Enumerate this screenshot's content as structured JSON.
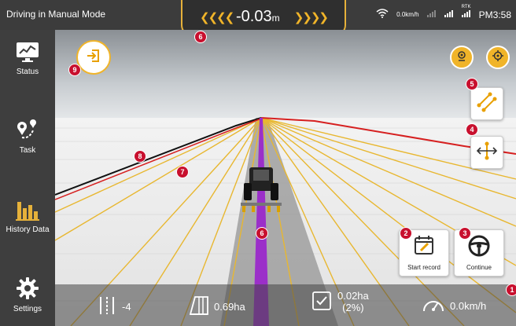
{
  "status_bar": {
    "mode": "Driving in Manual Mode",
    "speed_label": "0.0km/h",
    "rtk_label": "RTK",
    "time": "PM3:58"
  },
  "offset": {
    "value": "-0.03",
    "unit": "m"
  },
  "sidebar": {
    "items": [
      {
        "label": "Status"
      },
      {
        "label": "Task"
      },
      {
        "label": "History Data"
      },
      {
        "label": "Settings"
      }
    ]
  },
  "actions": {
    "start_record": "Start record",
    "continue": "Continue"
  },
  "bottom": {
    "line_number": "-4",
    "area": "0.69ha",
    "worked_area": "0.02ha",
    "worked_percent": "(2%)",
    "speed": "0.0km/h"
  },
  "badges": [
    "1",
    "2",
    "3",
    "4",
    "5",
    "6",
    "6",
    "7",
    "8",
    "9"
  ],
  "colors": {
    "accent_yellow": "#f0b429",
    "guide_purple": "#9b2fc9",
    "badge_red": "#c8102e",
    "boundary_red": "#d62020"
  }
}
